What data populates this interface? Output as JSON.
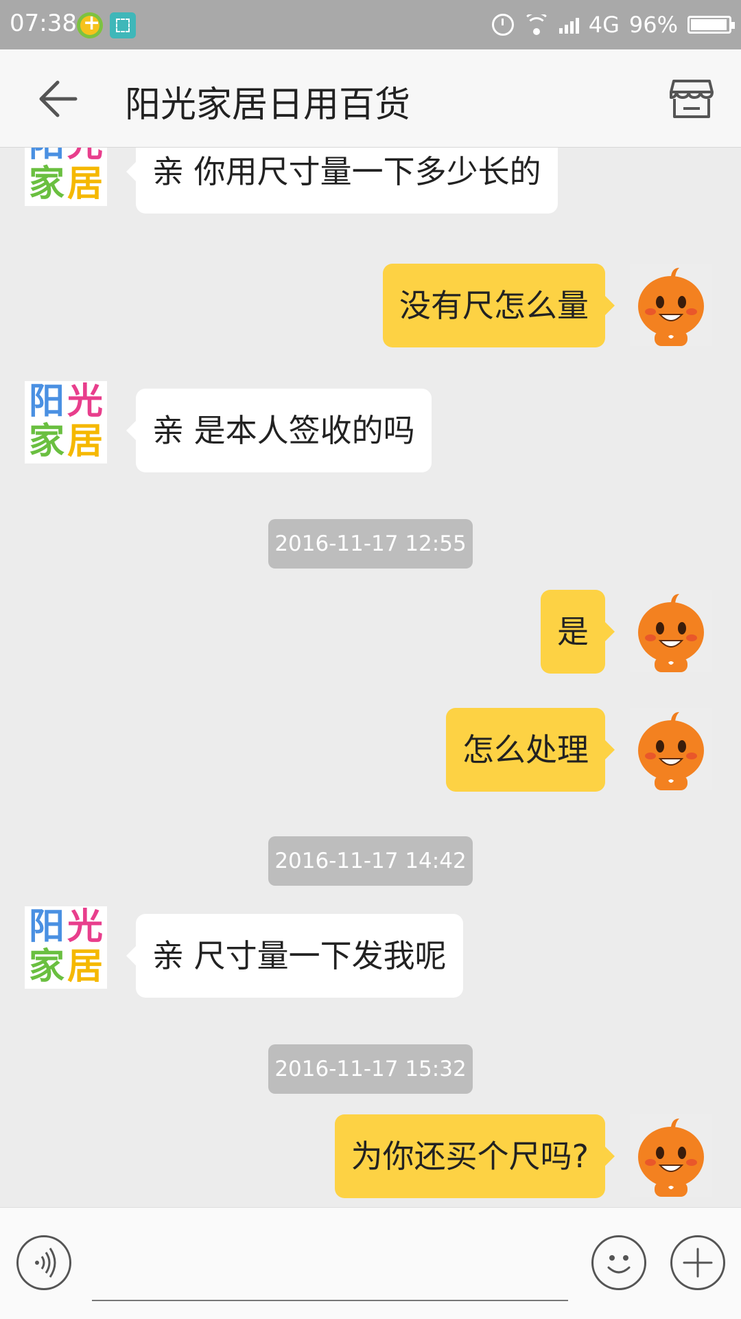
{
  "status_bar": {
    "time": "07:38",
    "network": "4G",
    "battery": "96%",
    "icons": [
      "notification-plus-icon",
      "screenshot-icon",
      "alarm-icon",
      "wifi-icon",
      "signal-icon",
      "battery-icon"
    ]
  },
  "header": {
    "title": "阳光家居日用百货",
    "back_icon": "back-arrow-icon",
    "shop_icon": "store-icon"
  },
  "shop_logo": {
    "char1": "阳",
    "char2": "光",
    "char3": "家",
    "char4": "居",
    "colors": [
      "#4a90e2",
      "#e83e8c",
      "#6abf40",
      "#f5b800"
    ]
  },
  "messages": [
    {
      "sender": "shop",
      "text": "亲 你用尺寸量一下多少长的"
    },
    {
      "sender": "me",
      "text": "没有尺怎么量"
    },
    {
      "sender": "shop",
      "text": "亲 是本人签收的吗"
    },
    {
      "type": "timestamp",
      "text": "2016-11-17 12:55"
    },
    {
      "sender": "me",
      "text": "是"
    },
    {
      "sender": "me",
      "text": "怎么处理"
    },
    {
      "type": "timestamp",
      "text": "2016-11-17 14:42"
    },
    {
      "sender": "shop",
      "text": "亲 尺寸量一下发我呢"
    },
    {
      "type": "timestamp",
      "text": "2016-11-17 15:32"
    },
    {
      "sender": "me",
      "text": "为你还买个尺吗?"
    }
  ],
  "input_bar": {
    "voice_icon": "voice-icon",
    "emoji_icon": "emoji-icon",
    "plus_icon": "plus-icon"
  },
  "colors": {
    "my_bubble": "#fdd244",
    "their_bubble": "#ffffff",
    "background": "#ececec",
    "timestamp_bg": "#bdbdbd"
  }
}
